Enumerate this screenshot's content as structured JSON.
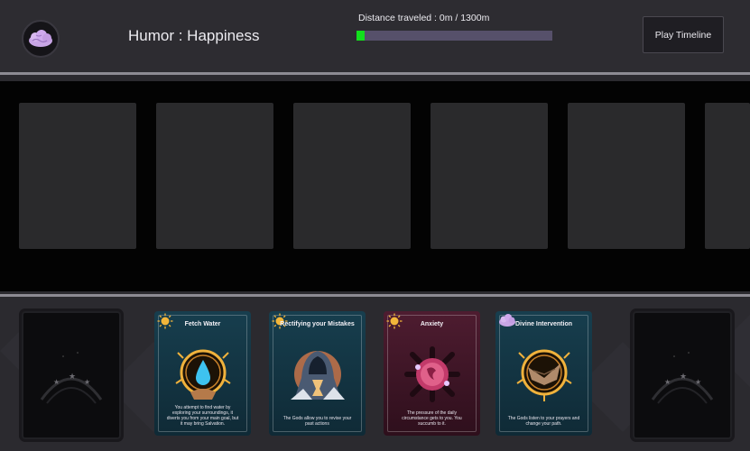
{
  "header": {
    "humor_label": "Humor : Happiness",
    "distance_label": "Distance traveled : 0m / 1300m",
    "distance_progress": 0.04,
    "play_button": "Play Timeline",
    "badge_icon": "brain-icon"
  },
  "colors": {
    "progress_fill": "#12e01c",
    "progress_track": "#56506a",
    "separator": "#8d8b93"
  },
  "timeline": {
    "slots": [
      {
        "state": "empty"
      },
      {
        "state": "empty"
      },
      {
        "state": "empty"
      },
      {
        "state": "empty"
      },
      {
        "state": "empty"
      },
      {
        "state": "empty"
      }
    ]
  },
  "hand": {
    "cards": [
      {
        "title": "Fetch Water",
        "description": "You attempt to find water by exploring your surroundings, it diverts you from your main goal, but it may bring Salvation.",
        "badge_icon": "sun-icon",
        "art_icon": "water-drop-icon",
        "color": "#123a4a"
      },
      {
        "title": "Rectifying your Mistakes",
        "description": "The Gods allow you to revise your past actions",
        "badge_icon": "sun-icon",
        "art_icon": "hooded-figure-icon",
        "color": "#123a4a"
      },
      {
        "title": "Anxiety",
        "description": "The pressure of the daily circumstance gets to you. You succumb to it.",
        "badge_icon": "sun-icon",
        "art_icon": "anxiety-eye-icon",
        "color": "#4a1a2e"
      },
      {
        "title": "Divine Intervention",
        "description": "The Gods listen to your prayers and change your path.",
        "badge_icon": "brain-icon",
        "art_icon": "divine-hands-icon",
        "color": "#123a4a"
      }
    ]
  }
}
